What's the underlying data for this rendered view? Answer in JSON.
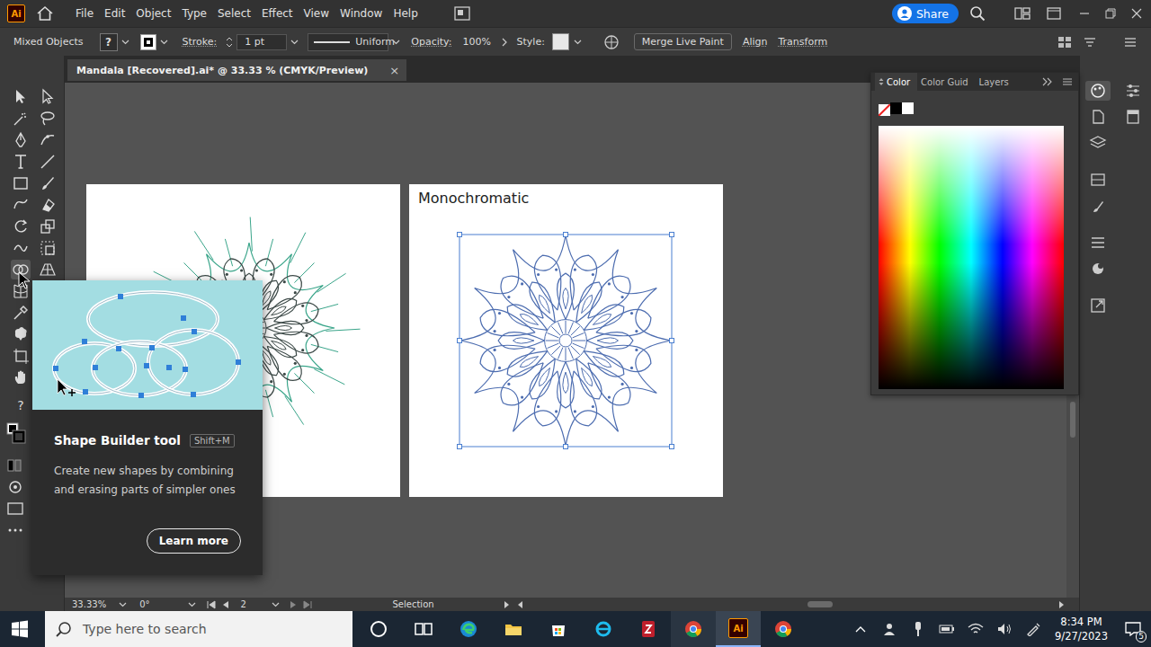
{
  "app": {
    "logo": "Ai"
  },
  "menu": [
    "File",
    "Edit",
    "Object",
    "Type",
    "Select",
    "Effect",
    "View",
    "Window",
    "Help"
  ],
  "share": "Share",
  "control_bar": {
    "selection": "Mixed Objects",
    "fill": "?",
    "stroke_label": "Stroke:",
    "stroke_weight": "1 pt",
    "profile": "Uniform",
    "opacity_label": "Opacity:",
    "opacity": "100%",
    "style_label": "Style:",
    "buttons": [
      "Merge Live Paint",
      "Align",
      "Transform"
    ]
  },
  "document_tab": {
    "title": "Mandala [Recovered].ai* @ 33.33 % (CMYK/Preview)",
    "close": "×"
  },
  "toolbar": {
    "help": "?"
  },
  "artboards": [
    {
      "label": "",
      "selected": false,
      "color": "#3aa58a"
    },
    {
      "label": "Monochromatic",
      "selected": true,
      "color": "#4d6db0"
    }
  ],
  "color_panel": {
    "tabs": [
      {
        "label": "Color",
        "selected": true
      },
      {
        "label": "Color Guid",
        "selected": false
      },
      {
        "label": "Layers",
        "selected": false
      }
    ]
  },
  "tooltip": {
    "title": "Shape Builder tool",
    "shortcut": "Shift+M",
    "description": "Create new shapes by combining and erasing parts of simpler ones",
    "button": "Learn more"
  },
  "status_bar": {
    "zoom": "33.33%",
    "rotation": "0°",
    "artboard": "2",
    "tool": "Selection"
  },
  "taskbar": {
    "search_placeholder": "Type here to search",
    "time": "8:34 PM",
    "date": "9/27/2023",
    "notifications": "5"
  }
}
